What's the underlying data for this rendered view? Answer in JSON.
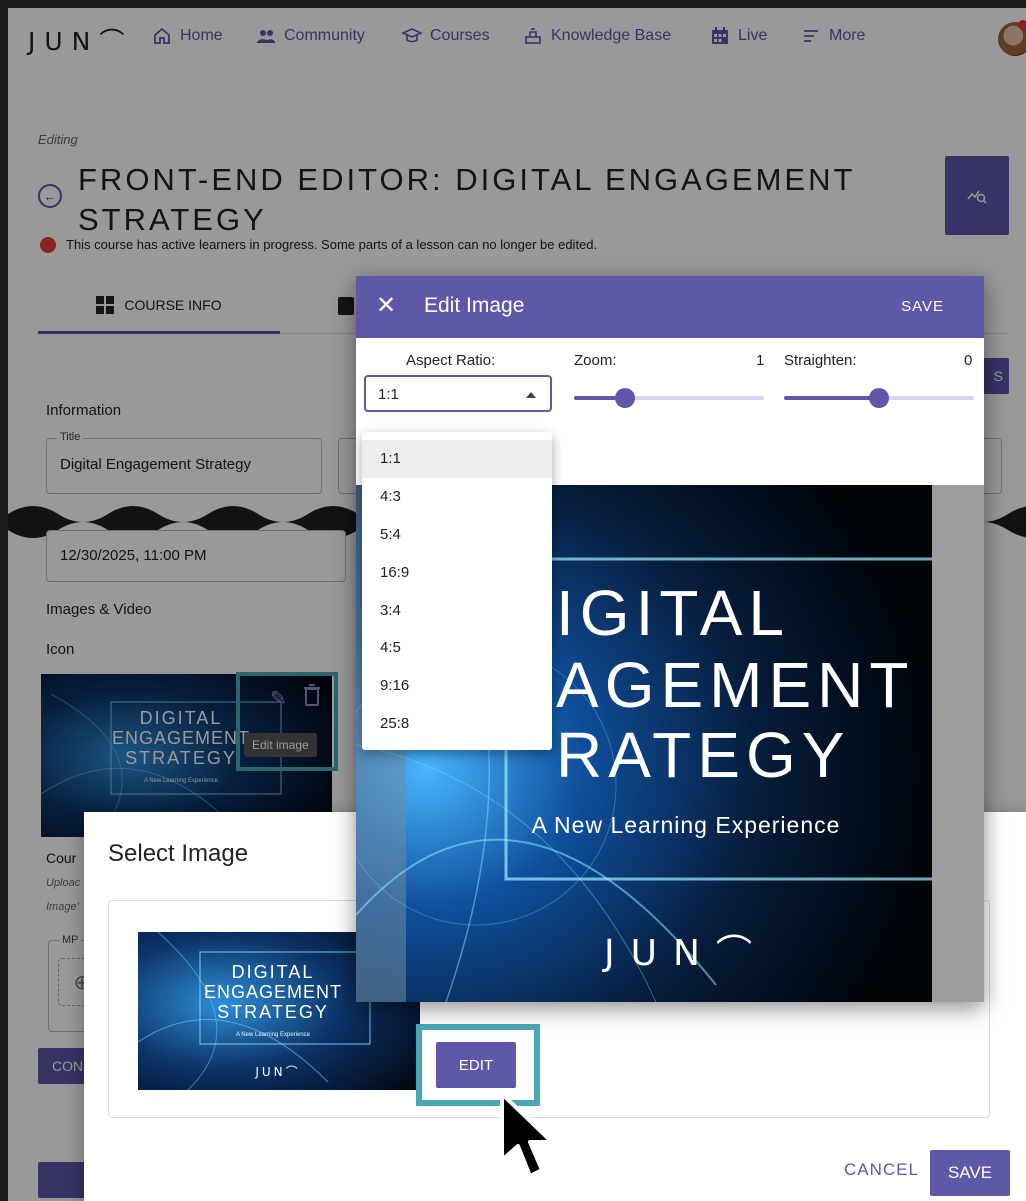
{
  "app": {
    "logo": "JUN⌒"
  },
  "nav": {
    "items": [
      {
        "label": "Home",
        "icon": "home-icon"
      },
      {
        "label": "Community",
        "icon": "community-icon"
      },
      {
        "label": "Courses",
        "icon": "graduation-cap-icon"
      },
      {
        "label": "Knowledge Base",
        "icon": "knowledge-base-icon"
      },
      {
        "label": "Live",
        "icon": "calendar-icon"
      },
      {
        "label": "More",
        "icon": "menu-icon"
      }
    ]
  },
  "header": {
    "editing": "Editing",
    "title": "FRONT-END EDITOR: DIGITAL ENGAGEMENT STRATEGY",
    "warning": "This course has active learners in progress. Some parts of a lesson can no longer be edited."
  },
  "tabs": {
    "course_info": "COURSE INFO"
  },
  "form": {
    "information_label": "Information",
    "title_legend": "Title",
    "title_value": "Digital Engagement Strategy",
    "date_value": "12/30/2025, 11:00 PM",
    "images_video_label": "Images & Video",
    "icon_label": "Icon",
    "edit_image_tooltip": "Edit image",
    "course_label": "Cour",
    "upload_label": "Uploac",
    "image_label": "Image'",
    "mp_legend": "MP",
    "con_button": "CON",
    "side_button": "S"
  },
  "thumbnail": {
    "line1": "DIGITAL",
    "line2": "ENGAGEMENT",
    "line3": "STRATEGY",
    "tagline": "A New Learning Experience",
    "brand": "JUN⌒"
  },
  "select_dialog": {
    "title": "Select Image",
    "edit_button": "EDIT",
    "cancel_button": "CANCEL",
    "save_button": "SAVE"
  },
  "edit_dialog": {
    "title": "Edit Image",
    "save": "SAVE",
    "aspect_label": "Aspect Ratio:",
    "aspect_value": "1:1",
    "zoom_label": "Zoom:",
    "zoom_value": "1",
    "zoom_level": 0.27,
    "straighten_label": "Straighten:",
    "straighten_value": "0",
    "straighten_level": 0.5,
    "aspect_options": [
      "1:1",
      "4:3",
      "5:4",
      "16:9",
      "3:4",
      "4:5",
      "9:16",
      "25:8"
    ],
    "preview": {
      "line1": "IGITAL",
      "line2": "AGEMENT",
      "line3": "RATEGY",
      "tagline": "A New Learning Experience",
      "brand": "JUN⌒"
    }
  },
  "colors": {
    "accent": "#5d58a8",
    "highlight": "#4aa8b4",
    "warning": "#e53935"
  }
}
